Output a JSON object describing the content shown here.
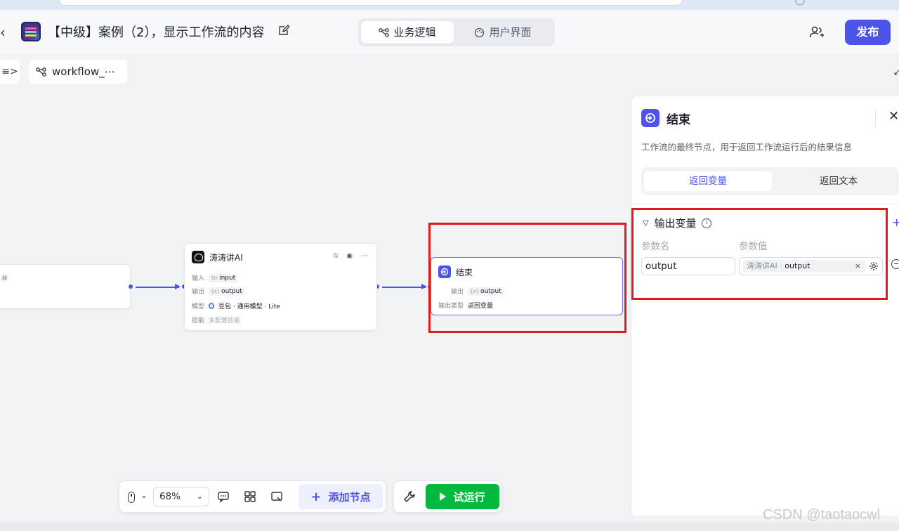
{
  "header": {
    "back_glyph": "‹",
    "title": "【中级】案例（2），显示工作流的内容",
    "tabs": [
      {
        "label": "业务逻辑",
        "active": true
      },
      {
        "label": "用户界面",
        "active": false
      }
    ],
    "publish_label": "发布"
  },
  "canvas": {
    "workflow_chip": "workflow_⋯",
    "sidebar_toggle": "≡>",
    "nodes": {
      "left_partial": {
        "tag": "器"
      },
      "ai": {
        "title": "涛涛讲AI",
        "input_label": "输入",
        "input_type": "Str",
        "input_value": "input",
        "output_label": "输出",
        "output_type": "{x}",
        "output_value": "output",
        "model_label": "模型",
        "model_value": "豆包 · 通用模型 · Lite",
        "skill_label": "技能",
        "skill_value": "未配置技能"
      },
      "end": {
        "title": "结束",
        "output_label": "输出",
        "output_type": "{x}",
        "output_value": "output",
        "output_type_label": "输出类型",
        "output_type_value": "返回变量"
      }
    }
  },
  "panel": {
    "title": "结束",
    "close_glyph": "✕",
    "description": "工作流的最终节点，用于返回工作流运行后的结果信息",
    "segments": [
      {
        "label": "返回变量",
        "active": true
      },
      {
        "label": "返回文本",
        "active": false
      }
    ],
    "section_title": "输出变量",
    "add_glyph": "+",
    "col_name": "参数名",
    "col_value": "参数值",
    "param_name": "output",
    "ref_source": "涛涛讲AI · ",
    "ref_var": "output",
    "ref_remove": "×"
  },
  "toolbar": {
    "zoom": "68%",
    "add_node_label": "添加节点",
    "run_label": "试运行"
  },
  "watermark": "CSDN @taotaocwl",
  "colors": {
    "accent": "#4d53e8",
    "run_green": "#00b93e",
    "highlight_red": "#e01b1b"
  }
}
